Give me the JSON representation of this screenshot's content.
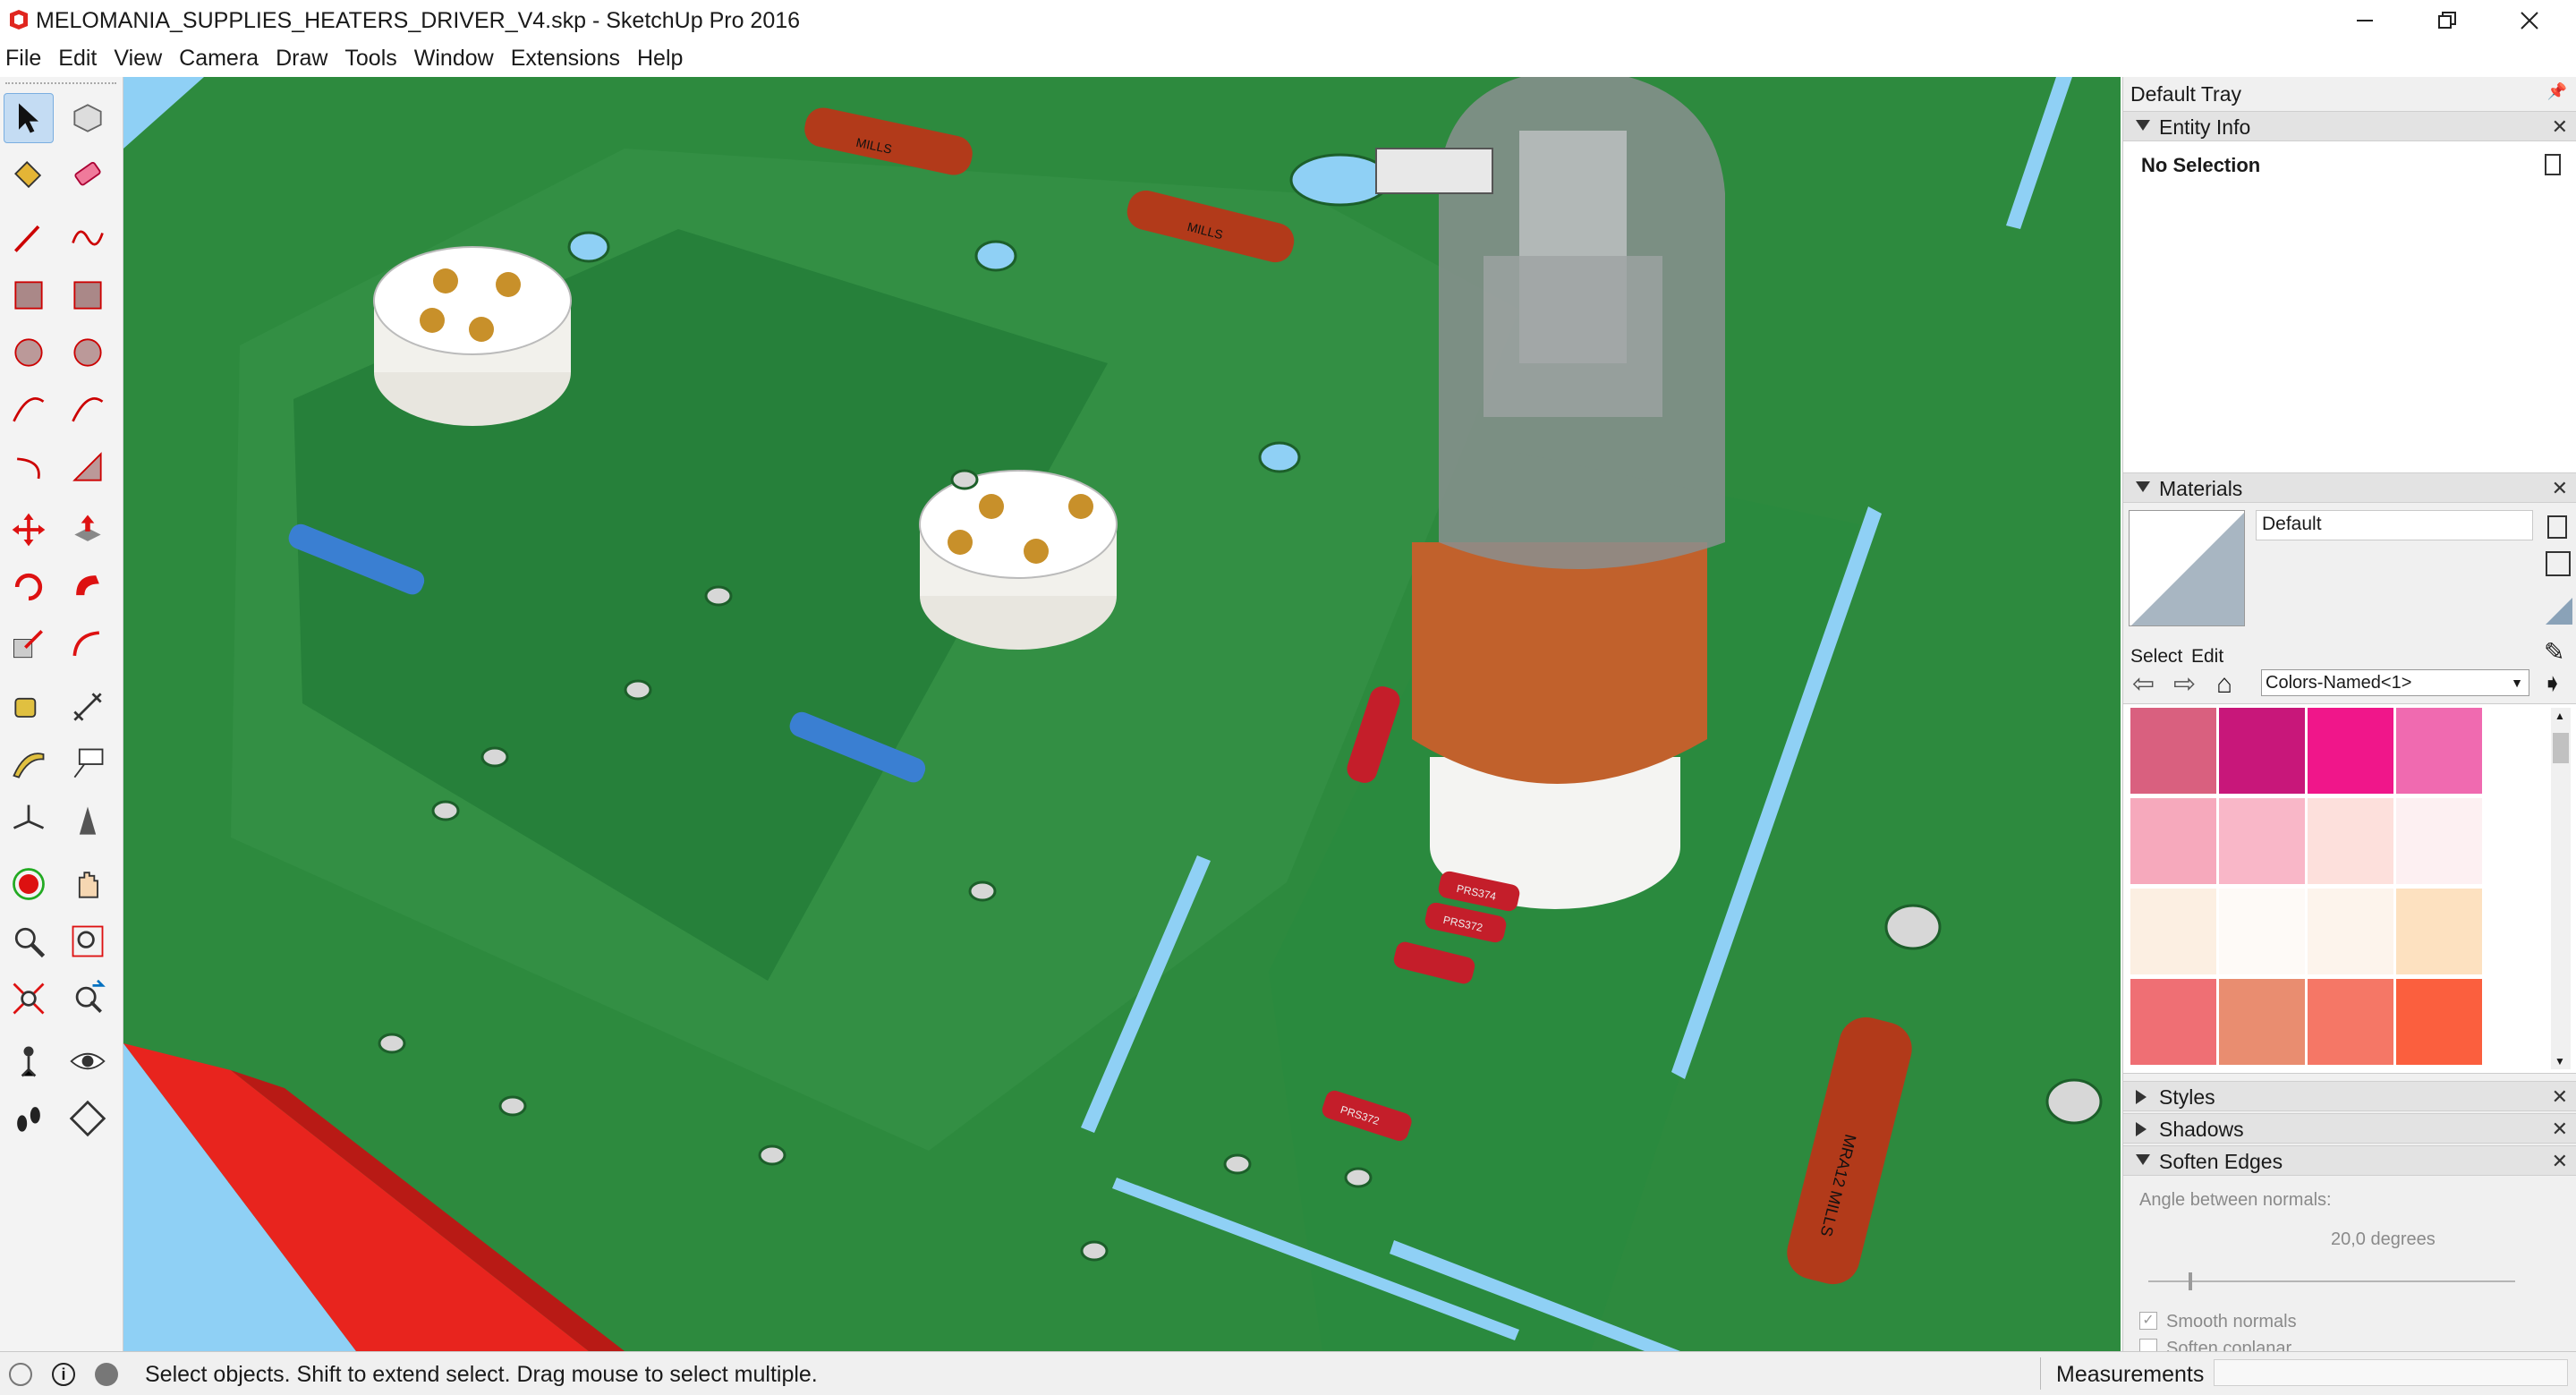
{
  "window": {
    "title": "MELOMANIA_SUPPLIES_HEATERS_DRIVER_V4.skp - SketchUp Pro 2016",
    "app_icon": "sketchup-icon",
    "controls": [
      "minimize-icon",
      "restore-icon",
      "close-icon"
    ]
  },
  "menu": {
    "items": [
      "File",
      "Edit",
      "View",
      "Camera",
      "Draw",
      "Tools",
      "Window",
      "Extensions",
      "Help"
    ]
  },
  "toolbar": {
    "tools": [
      [
        "select-icon",
        "make-component-icon"
      ],
      [
        "paint-bucket-icon",
        "eraser-icon"
      ],
      [
        "pencil-line-icon",
        "freehand-icon"
      ],
      [
        "rectangle-icon",
        "rotated-rectangle-icon"
      ],
      [
        "circle-icon",
        "polygon-icon"
      ],
      [
        "arc-icon",
        "two-point-arc-icon"
      ],
      [
        "three-point-arc-icon",
        "pie-icon"
      ],
      [
        "move-icon",
        "push-pull-icon"
      ],
      [
        "rotate-icon",
        "follow-me-icon"
      ],
      [
        "scale-icon",
        "offset-icon"
      ],
      [
        "tape-measure-icon",
        "dimension-icon"
      ],
      [
        "protractor-icon",
        "text-icon"
      ],
      [
        "axes-icon",
        "3d-text-icon"
      ],
      [
        "orbit-icon",
        "pan-icon"
      ],
      [
        "zoom-icon",
        "zoom-window-icon"
      ],
      [
        "zoom-extents-icon",
        "previous-view-icon"
      ],
      [
        "position-camera-icon",
        "look-around-icon"
      ],
      [
        "walk-icon",
        "section-plane-icon"
      ]
    ],
    "active_tool": "select-icon"
  },
  "tray": {
    "title": "Default Tray",
    "entity_info": {
      "label": "Entity Info",
      "selection_text": "No Selection"
    },
    "materials": {
      "label": "Materials",
      "current_name": "Default",
      "tab_select": "Select",
      "tab_edit": "Edit",
      "library": "Colors-Named<1>",
      "swatches": [
        "#d9607f",
        "#c8177a",
        "#f0168a",
        "#f06ab0",
        "#f6a9bc",
        "#f9b7c8",
        "#fde0dc",
        "#fdf0f2",
        "#fcefe2",
        "#fefaf7",
        "#fdf4ec",
        "#fde1c0",
        "#ef6f74",
        "#e98d70",
        "#f57766",
        "#fb5f3e"
      ]
    },
    "styles_label": "Styles",
    "shadows_label": "Shadows",
    "soften_edges": {
      "label": "Soften Edges",
      "angle_label": "Angle between normals:",
      "angle_value": "20,0  degrees",
      "angle_fraction": 0.11,
      "smooth_normals_label": "Smooth normals",
      "smooth_normals_checked": true,
      "soften_coplanar_label": "Soften coplanar",
      "soften_coplanar_checked": false
    }
  },
  "status": {
    "icons": [
      "geo-location-icon",
      "credits-icon",
      "user-icon"
    ],
    "text": "Select objects. Shift to extend select. Drag mouse to select multiple.",
    "measurements_label": "Measurements",
    "measurements_value": ""
  },
  "scene": {
    "board_color": "#2d8a3e",
    "sky_color": "#8fd0f5",
    "resistor_labels": [
      "MILLS",
      "MILLS",
      "PRS374",
      "PRS372",
      "PRS372",
      "MRA12 MILLS"
    ]
  }
}
